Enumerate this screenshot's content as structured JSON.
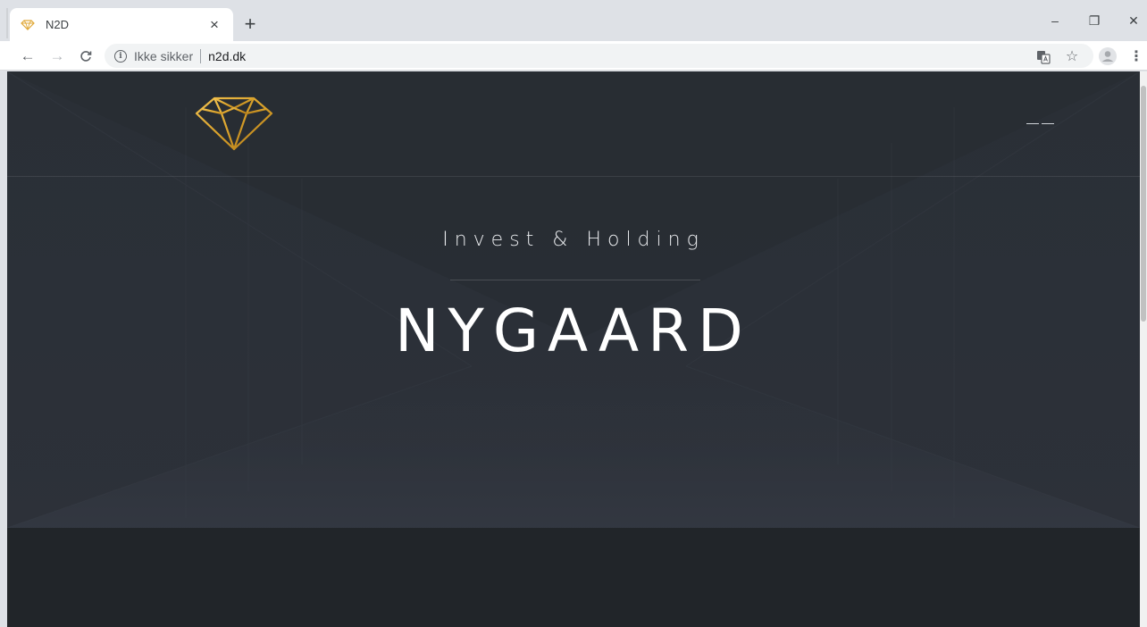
{
  "browser": {
    "tab": {
      "title": "N2D",
      "close": "×"
    },
    "new_tab": "+",
    "window_controls": {
      "minimize": "–",
      "restore": "❐",
      "close": "✕"
    },
    "nav": {
      "back": "←",
      "forward": "→",
      "reload": "C"
    },
    "omnibox": {
      "info": "i",
      "security_label": "Ikke sikker",
      "url": "n2d.dk"
    },
    "toolbar_icons": {
      "translate": "⊞",
      "bookmark": "☆",
      "menu": "⋮"
    }
  },
  "page": {
    "subtitle": "Invest & Holding",
    "title": "NYGAARD"
  },
  "colors": {
    "logo_gold": "#d9a12a",
    "hero_background": "#2b3038",
    "lower_section": "#212529"
  },
  "icons": {
    "favicon": "diamond-icon",
    "logo": "diamond-logo-icon",
    "menu": "hamburger-menu-icon"
  }
}
